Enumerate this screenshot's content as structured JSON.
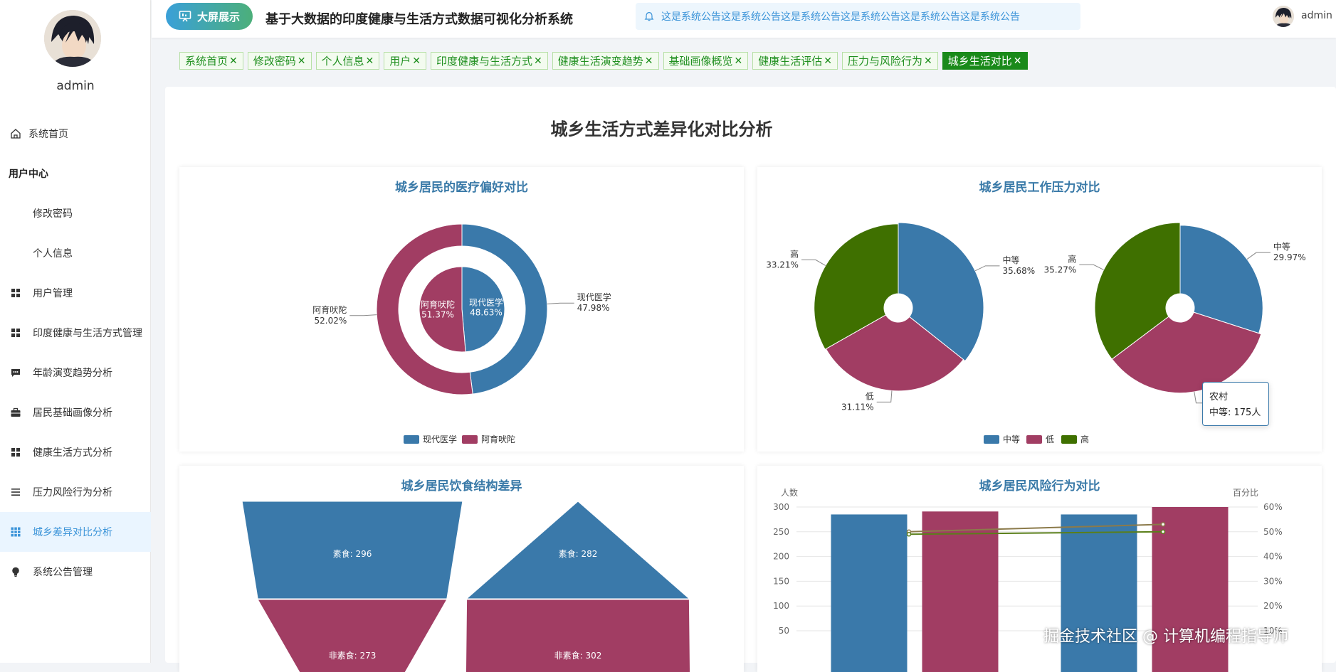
{
  "user": {
    "name": "admin"
  },
  "sidebar": {
    "items": [
      {
        "label": "系统首页",
        "icon": "home-icon"
      },
      {
        "group": "用户中心"
      },
      {
        "label": "修改密码"
      },
      {
        "label": "个人信息"
      },
      {
        "label": "用户管理",
        "icon": "grid-icon"
      },
      {
        "label": "印度健康与生活方式管理",
        "icon": "grid-icon"
      },
      {
        "label": "年龄演变趋势分析",
        "icon": "chat-icon"
      },
      {
        "label": "居民基础画像分析",
        "icon": "briefcase-icon"
      },
      {
        "label": "健康生活方式分析",
        "icon": "grid-icon"
      },
      {
        "label": "压力风险行为分析",
        "icon": "list-icon"
      },
      {
        "label": "城乡差异对比分析",
        "icon": "apps-icon",
        "active": true
      },
      {
        "label": "系统公告管理",
        "icon": "bulb-icon"
      }
    ]
  },
  "header": {
    "big_screen_label": "大屏展示",
    "title": "基于大数据的印度健康与生活方式数据可视化分析系统",
    "notice": "这是系统公告这是系统公告这是系统公告这是系统公告这是系统公告这是系统公告",
    "user": "admin"
  },
  "tabs": [
    {
      "label": "系统首页"
    },
    {
      "label": "修改密码"
    },
    {
      "label": "个人信息"
    },
    {
      "label": "用户"
    },
    {
      "label": "印度健康与生活方式"
    },
    {
      "label": "健康生活演变趋势"
    },
    {
      "label": "基础画像概览"
    },
    {
      "label": "健康生活评估"
    },
    {
      "label": "压力与风险行为"
    },
    {
      "label": "城乡生活对比",
      "active": true
    }
  ],
  "tab_close": "✕",
  "page_title": "城乡生活方式差异化对比分析",
  "colors": {
    "blue": "#3a79aa",
    "red": "#a13d63",
    "green": "#3f7000",
    "accent": "#3a93d8",
    "tag_green": "#1a8a1a"
  },
  "charts": {
    "medical": {
      "title": "城乡居民的医疗偏好对比"
    },
    "stress": {
      "title": "城乡居民工作压力对比"
    },
    "diet": {
      "title": "城乡居民饮食结构差异"
    },
    "risk": {
      "title": "城乡居民风险行为对比",
      "y_left_label": "人数",
      "y_right_label": "百分比"
    }
  },
  "tooltip": {
    "title": "农村",
    "text": "中等: 175人"
  },
  "watermark": "掘金技术社区 @ 计算机编程指导师",
  "chart_data": [
    {
      "type": "pie",
      "title": "城乡居民的医疗偏好对比",
      "legend": [
        "现代医学",
        "阿育吠陀"
      ],
      "rings": [
        {
          "name": "inner",
          "slices": [
            {
              "label": "现代医学",
              "percent": 48.63
            },
            {
              "label": "阿育吠陀",
              "percent": 51.37
            }
          ]
        },
        {
          "name": "outer",
          "slices": [
            {
              "label": "现代医学",
              "percent": 47.98
            },
            {
              "label": "阿育吠陀",
              "percent": 52.02
            }
          ]
        }
      ],
      "legend_position": "bottom"
    },
    {
      "type": "pie",
      "title": "城乡居民工作压力对比",
      "legend": [
        "中等",
        "低",
        "高"
      ],
      "pies": [
        {
          "slices": [
            {
              "label": "中等",
              "percent": 35.68
            },
            {
              "label": "低",
              "percent": 31.11
            },
            {
              "label": "高",
              "percent": 33.21
            }
          ]
        },
        {
          "name": "农村",
          "slices": [
            {
              "label": "中等",
              "percent": 29.97,
              "value": 175
            },
            {
              "label": "低",
              "percent": 34.76
            },
            {
              "label": "高",
              "percent": 35.27
            }
          ]
        }
      ],
      "legend_position": "bottom"
    },
    {
      "type": "funnel",
      "title": "城乡居民饮食结构差异",
      "funnels": [
        {
          "segments": [
            {
              "label": "素食",
              "value": 296
            },
            {
              "label": "非素食",
              "value": 273
            }
          ]
        },
        {
          "segments": [
            {
              "label": "素食",
              "value": 282
            },
            {
              "label": "非素食",
              "value": 302
            }
          ]
        }
      ]
    },
    {
      "type": "bar",
      "title": "城乡居民风险行为对比",
      "ylabel": "人数",
      "ylabel_right": "百分比",
      "ylim": [
        50,
        300
      ],
      "yticks": [
        300,
        250,
        200,
        150,
        100,
        50
      ],
      "ylim_right": [
        "10%",
        "60%"
      ],
      "yticks_right": [
        "60%",
        "50%",
        "40%",
        "30%",
        "20%",
        "10%"
      ],
      "bars": [
        {
          "group": 1,
          "values": [
            285,
            291
          ]
        },
        {
          "group": 2,
          "values": [
            285,
            300
          ]
        }
      ],
      "lines": [
        {
          "values": [
            50,
            53
          ]
        },
        {
          "values": [
            49,
            50
          ]
        }
      ],
      "grid": true
    }
  ]
}
